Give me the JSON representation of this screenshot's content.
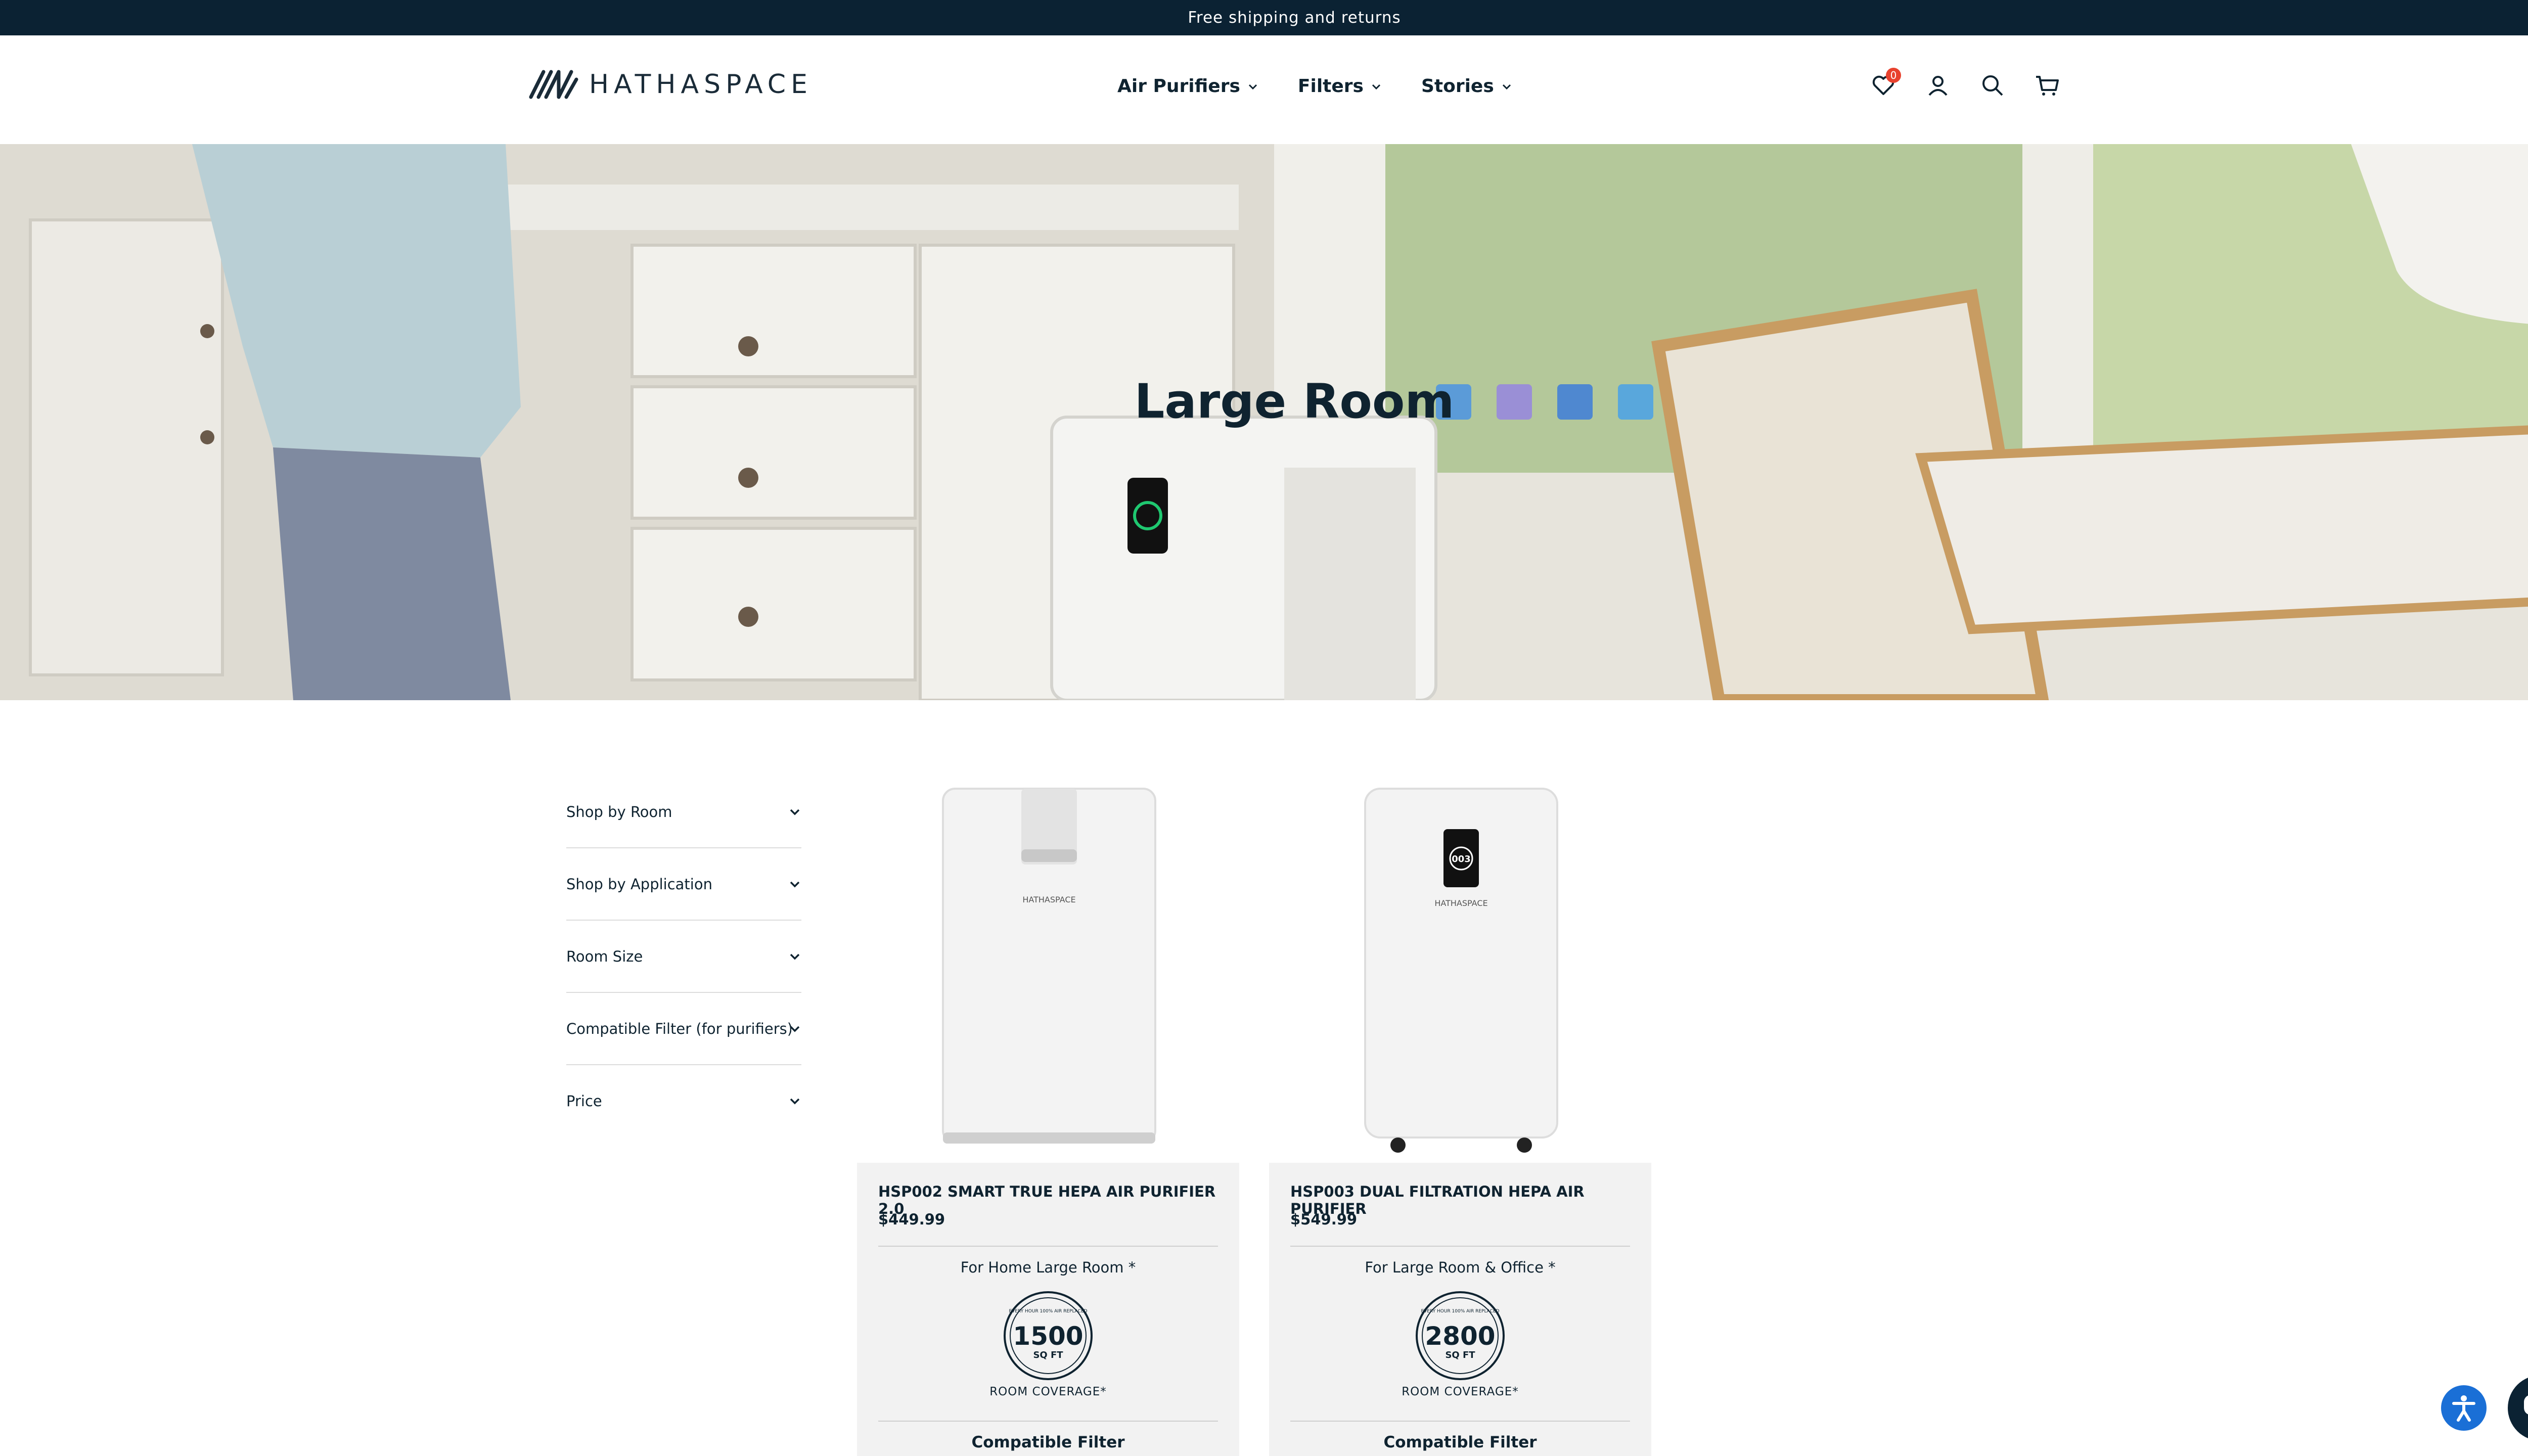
{
  "announcement": "Free shipping and returns",
  "brand": {
    "name": "HATHASPACE"
  },
  "nav": [
    {
      "label": "Air Purifiers"
    },
    {
      "label": "Filters"
    },
    {
      "label": "Stories"
    }
  ],
  "header_icons": {
    "wishlist_count": "0",
    "icons": [
      "heart-icon",
      "account-icon",
      "search-icon",
      "cart-icon"
    ]
  },
  "hero": {
    "title": "Large Room"
  },
  "sidebar": {
    "filters": [
      {
        "label": "Shop by Room"
      },
      {
        "label": "Shop by Application"
      },
      {
        "label": "Room Size"
      },
      {
        "label": "Compatible Filter (for purifiers)"
      },
      {
        "label": "Price"
      }
    ]
  },
  "products": [
    {
      "name": "HSP002 SMART TRUE HEPA AIR PURIFIER 2.0",
      "price": "$449.99",
      "for": "For Home Large Room *",
      "badge_top": "EVERY HOUR 100% AIR REPLACED",
      "coverage_value": "1500",
      "coverage_unit": "SQ FT",
      "coverage_caption": "ROOM COVERAGE*",
      "compat": "Compatible Filter",
      "device_label": "HATHASPACE"
    },
    {
      "name": "HSP003 DUAL FILTRATION HEPA AIR PURIFIER",
      "price": "$549.99",
      "for": "For Large Room & Office *",
      "badge_top": "EVERY HOUR 100% AIR REPLACED",
      "coverage_value": "2800",
      "coverage_unit": "SQ FT",
      "coverage_caption": "ROOM COVERAGE*",
      "compat": "Compatible Filter",
      "device_label": "HATHASPACE",
      "display_readout": "003"
    }
  ],
  "colors": {
    "topbar": "#0b2233",
    "accent_badge": "#e8422e",
    "access": "#1a6fd6",
    "card_bg": "#f2f2f2"
  }
}
